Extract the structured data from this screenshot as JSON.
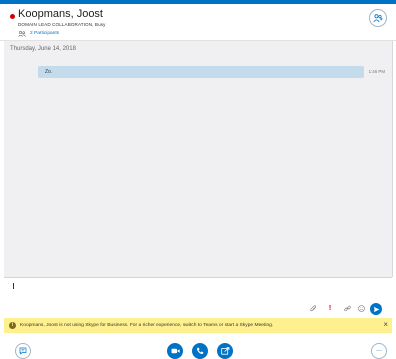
{
  "window": {
    "accent_color": "#0073c6"
  },
  "contact": {
    "name": "Koopmans, Joost",
    "title": "DOMAIN LEAD COLLABORATION",
    "status": "Busy",
    "status_color": "#d40000",
    "participants_label": "2 Participants"
  },
  "conversation": {
    "date": "Thursday, June 14, 2018",
    "messages": [
      {
        "text": "Zo.",
        "time": "1:46 PM"
      }
    ]
  },
  "compose": {
    "tools": [
      "attachment-icon",
      "important-icon",
      "link-icon",
      "emoticon-icon"
    ],
    "send_icon": "send-icon"
  },
  "notification": {
    "text": "Koopmans, Joost is not using Skype for Business. For a richer experience, switch to Teams or start a Skype Meeting.",
    "close_glyph": "×",
    "background": "#fff08f"
  },
  "bottom_bar": {
    "actions": [
      "video-icon",
      "phone-icon",
      "share-screen-icon"
    ],
    "left_icon": "chat-icon",
    "more_glyph": "..."
  }
}
